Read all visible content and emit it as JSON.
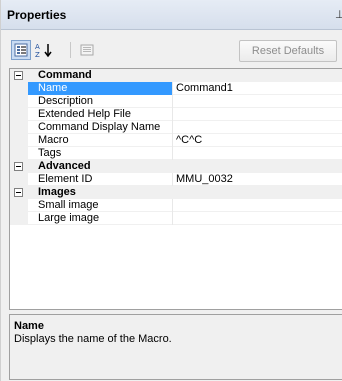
{
  "panel": {
    "title": "Properties",
    "pin_glyph": "⊥"
  },
  "toolbar": {
    "categorized_icon": "categorized-view-icon",
    "alphabetical_icon": "alphabetical-sort-icon",
    "alphabetical_glyph": "↓",
    "property_pages_icon": "property-pages-icon",
    "reset_label": "Reset Defaults"
  },
  "grid": {
    "categories": [
      {
        "name": "Command",
        "properties": [
          {
            "label": "Name",
            "value": "Command1",
            "selected": true
          },
          {
            "label": "Description",
            "value": ""
          },
          {
            "label": "Extended Help File",
            "value": ""
          },
          {
            "label": "Command Display Name",
            "value": ""
          },
          {
            "label": "Macro",
            "value": "^C^C"
          },
          {
            "label": "Tags",
            "value": ""
          }
        ]
      },
      {
        "name": "Advanced",
        "properties": [
          {
            "label": "Element ID",
            "value": "MMU_0032"
          }
        ]
      },
      {
        "name": "Images",
        "properties": [
          {
            "label": "Small image",
            "value": ""
          },
          {
            "label": "Large image",
            "value": ""
          }
        ]
      }
    ]
  },
  "help": {
    "title": "Name",
    "description": "Displays the name of the Macro."
  },
  "colors": {
    "selection": "#3399ff",
    "gutter": "#f0f0f0",
    "border": "#a0a0a0"
  }
}
